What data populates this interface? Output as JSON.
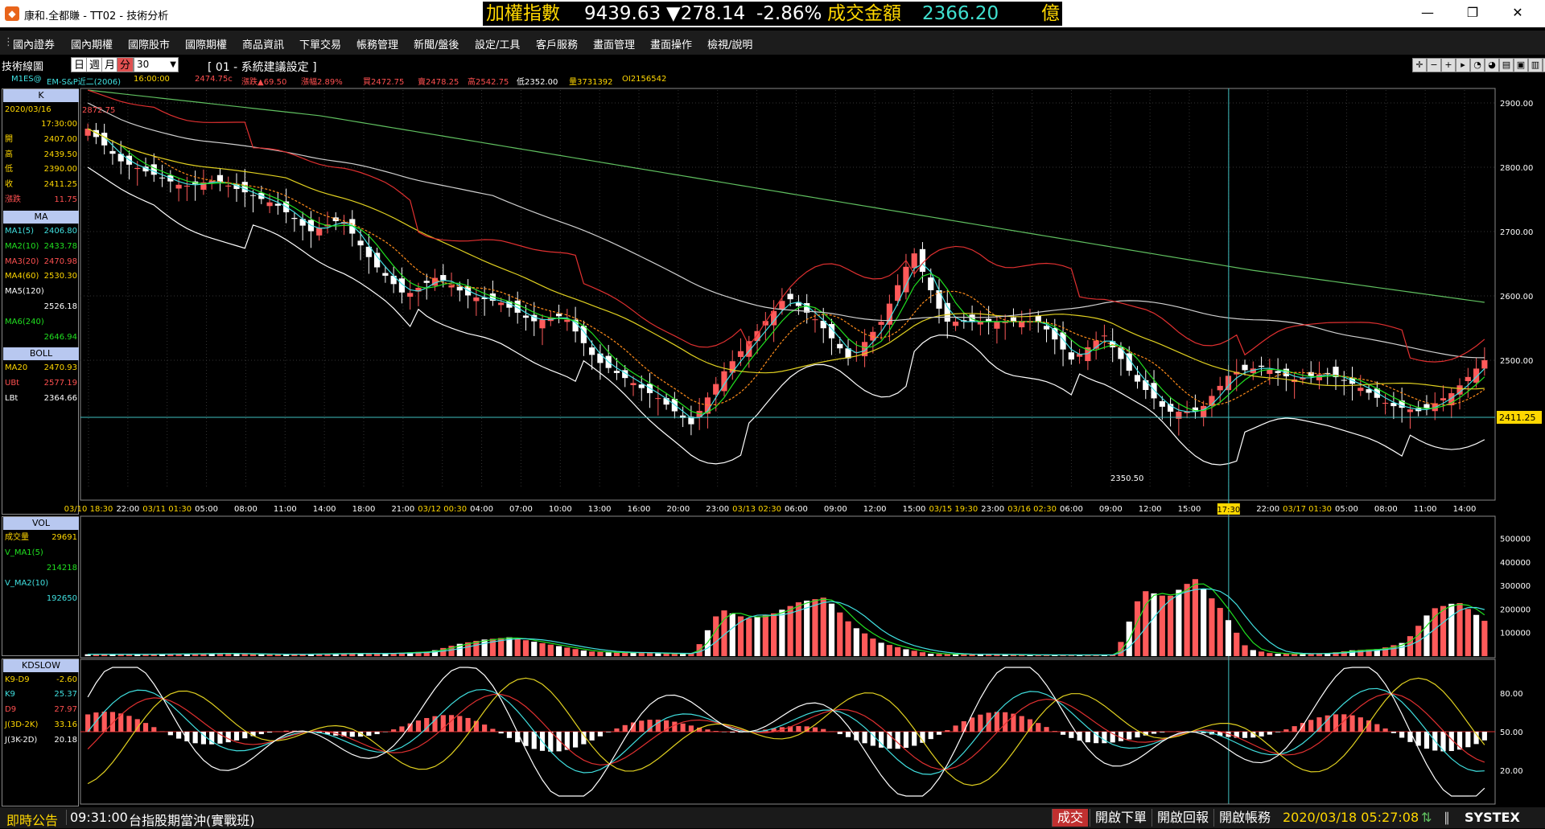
{
  "window": {
    "title": "康和.全都賺 - TT02 - 技術分析",
    "minimize": "—",
    "restore": "❐",
    "close": "✕"
  },
  "ticker": {
    "index_label": "加權指數",
    "index_value": "9439.63",
    "change": "▼278.14",
    "change_pct": "-2.86%",
    "turnover_label": "成交金額",
    "turnover_value": "2366.20",
    "unit": "億"
  },
  "menu": [
    "國內證券",
    "國內期權",
    "國際股市",
    "國際期權",
    "商品資訊",
    "下單交易",
    "帳務管理",
    "新聞/盤後",
    "設定/工具",
    "客戶服務",
    "畫面管理",
    "畫面操作",
    "檢視/說明"
  ],
  "chart_toolbar": {
    "tech_label": "技術線圖",
    "periods": [
      "日",
      "週",
      "月",
      "分"
    ],
    "active_period": "分",
    "count": "30",
    "settings": "[ 01 - 系統建議設定 ]"
  },
  "info": {
    "symbol": "M1ES@",
    "name": "EM-S&P近二(2006)",
    "time": "16:00:00",
    "price": "2474.75c",
    "change": "漲跌▲69.50",
    "change_pct": "漲幅2.89%",
    "bid": "買2472.75",
    "ask": "賣2478.25",
    "high": "高2542.75",
    "low": "低2352.00",
    "volume": "量3731392",
    "oi": "OI2156542"
  },
  "left_panel": {
    "k_header": "K",
    "date": "2020/03/16",
    "time": "17:30:00",
    "k_rows": [
      {
        "label": "開",
        "value": "2407.00"
      },
      {
        "label": "高",
        "value": "2439.50"
      },
      {
        "label": "低",
        "value": "2390.00"
      },
      {
        "label": "收",
        "value": "2411.25"
      },
      {
        "label": "漲跌",
        "value": "11.75"
      }
    ],
    "ma_header": "MA",
    "ma_rows": [
      {
        "label": "MA1(5)",
        "value": "2406.80"
      },
      {
        "label": "MA2(10)",
        "value": "2433.78"
      },
      {
        "label": "MA3(20)",
        "value": "2470.98"
      },
      {
        "label": "MA4(60)",
        "value": "2530.30"
      },
      {
        "label": "MA5(120)",
        "value": ""
      },
      {
        "label": "",
        "value": "2526.18"
      },
      {
        "label": "MA6(240)",
        "value": ""
      },
      {
        "label": "",
        "value": "2646.94"
      }
    ],
    "boll_header": "BOLL",
    "boll_rows": [
      {
        "label": "MA20",
        "value": "2470.93"
      },
      {
        "label": "UBt",
        "value": "2577.19"
      },
      {
        "label": "LBt",
        "value": "2364.66"
      }
    ],
    "vol_header": "VOL",
    "vol_rows": [
      {
        "label": "成交量",
        "value": "29691"
      },
      {
        "label": "V_MA1(5)",
        "value": ""
      },
      {
        "label": "",
        "value": "214218"
      },
      {
        "label": "V_MA2(10)",
        "value": ""
      },
      {
        "label": "",
        "value": "192650"
      }
    ],
    "kd_header": "KDSLOW",
    "kd_rows": [
      {
        "label": "K9-D9",
        "value": "-2.60"
      },
      {
        "label": "K9",
        "value": "25.37"
      },
      {
        "label": "D9",
        "value": "27.97"
      },
      {
        "label": "J(3D-2K)",
        "value": "33.16"
      },
      {
        "label": "J(3K-2D)",
        "value": "20.18"
      }
    ]
  },
  "chart_data": [
    {
      "type": "candlestick",
      "title": "",
      "ylim": [
        2300,
        2920
      ],
      "y_ticks": [
        "2900.00",
        "2800.00",
        "2700.00",
        "2600.00",
        "2500.00"
      ],
      "current_price_label": "2411.25",
      "high_label": "2872.75",
      "low_label": "2350.50",
      "crosshair_label": "17:30",
      "x_ticks": [
        "03/10 18:30",
        "22:00",
        "03/11 01:30",
        "05:00",
        "08:00",
        "11:00",
        "14:00",
        "18:00",
        "21:00",
        "03/12 00:30",
        "04:00",
        "07:00",
        "10:00",
        "13:00",
        "16:00",
        "20:00",
        "23:00",
        "03/13 02:30",
        "06:00",
        "09:00",
        "12:00",
        "15:00",
        "03/15 19:30",
        "23:00",
        "03/16 02:30",
        "06:00",
        "09:00",
        "12:00",
        "15:00",
        "17:30",
        "22:00",
        "03/17 01:30",
        "05:00",
        "08:00",
        "11:00",
        "14:00"
      ]
    },
    {
      "type": "bar",
      "title": "VOL",
      "ylim": [
        0,
        560000
      ],
      "y_ticks": [
        "500000",
        "400000",
        "300000",
        "200000",
        "100000"
      ]
    },
    {
      "type": "bar",
      "title": "KDSLOW",
      "ylim": [
        0,
        100
      ],
      "y_ticks": [
        "80.00",
        "50.00",
        "20.00"
      ]
    }
  ],
  "status": {
    "announce": "即時公告",
    "time": "09:31:00",
    "message": "台指股期當沖(實戰班)",
    "btn_trade": "成交",
    "btn_order": "開啟下單",
    "btn_report": "開啟回報",
    "btn_account": "開啟帳務",
    "datetime": "2020/03/18 05:27:08",
    "brand": "SYSTEX"
  },
  "colors": {
    "up": "#ff5a5a",
    "down": "#ffffff",
    "ma1": "#40e0e0",
    "ma2": "#20e020",
    "ma3": "#ff8c1a",
    "ma4": "#e0d020",
    "ma5": "#d0d0d0",
    "ma6": "#60c060",
    "boll": "#e03030"
  }
}
